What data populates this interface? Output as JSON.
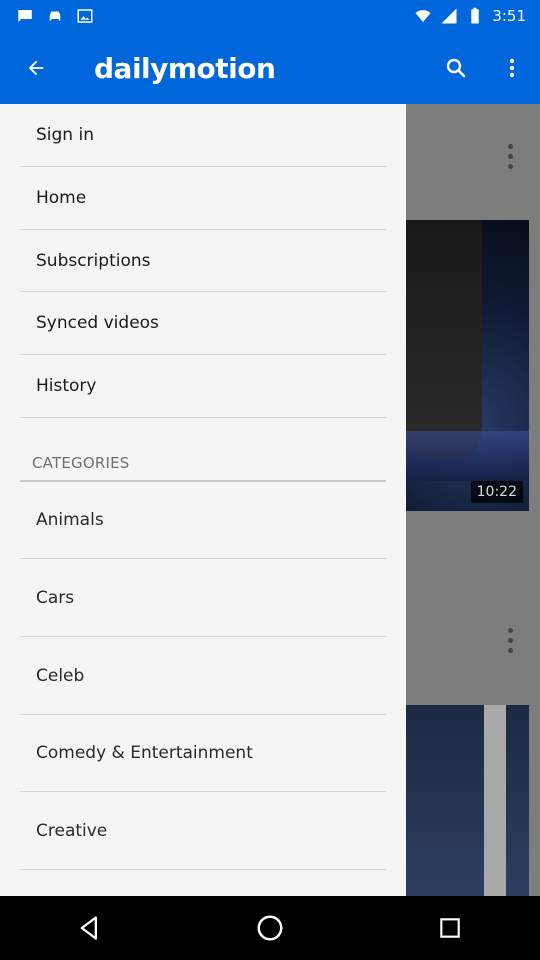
{
  "status_bar": {
    "time": "3:51",
    "icons": [
      "message-icon",
      "car-icon",
      "photo-icon",
      "wifi-icon",
      "signal-icon",
      "battery-icon"
    ]
  },
  "app_bar": {
    "title": "dailymotion",
    "back_icon": "arrow-back-icon",
    "search_icon": "search-icon",
    "more_icon": "more-vert-icon"
  },
  "drawer": {
    "items": [
      {
        "label": "Sign in"
      },
      {
        "label": "Home"
      },
      {
        "label": "Subscriptions"
      },
      {
        "label": "Synced videos"
      },
      {
        "label": "History"
      }
    ],
    "categories_header": "CATEGORIES",
    "categories": [
      {
        "label": "Animals"
      },
      {
        "label": "Cars"
      },
      {
        "label": "Celeb"
      },
      {
        "label": "Comedy & Entertainment"
      },
      {
        "label": "Creative"
      }
    ]
  },
  "background": {
    "video_duration": "10:22"
  },
  "nav_bar": {
    "buttons": [
      "back-nav-icon",
      "home-nav-icon",
      "recents-nav-icon"
    ]
  },
  "colors": {
    "brand": "#0066dc",
    "drawer_bg": "#f5f5f5",
    "scrim": "#7d7d7d"
  }
}
